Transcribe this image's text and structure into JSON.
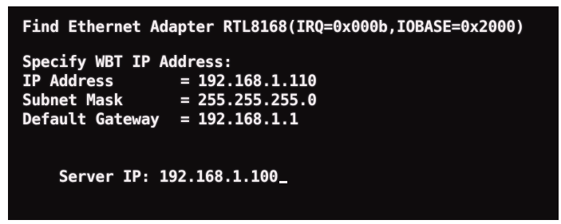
{
  "console": {
    "detect_line": "Find Ethernet Adapter RTL8168(IRQ=0x000b,IOBASE=0x2000)",
    "specify_heading": "Specify WBT IP Address:",
    "fields": [
      {
        "label": "IP Address",
        "eq": "=",
        "value": "192.168.1.110"
      },
      {
        "label": "Subnet Mask",
        "eq": "=",
        "value": "255.255.255.0"
      },
      {
        "label": "Default Gateway",
        "eq": "=",
        "value": "192.168.1.1"
      }
    ],
    "server_prompt": "Server IP: ",
    "server_value": "192.168.1.100"
  },
  "colors": {
    "background": "#0f0c0d",
    "text": "#f4eef0",
    "frame": "#ffffff"
  }
}
